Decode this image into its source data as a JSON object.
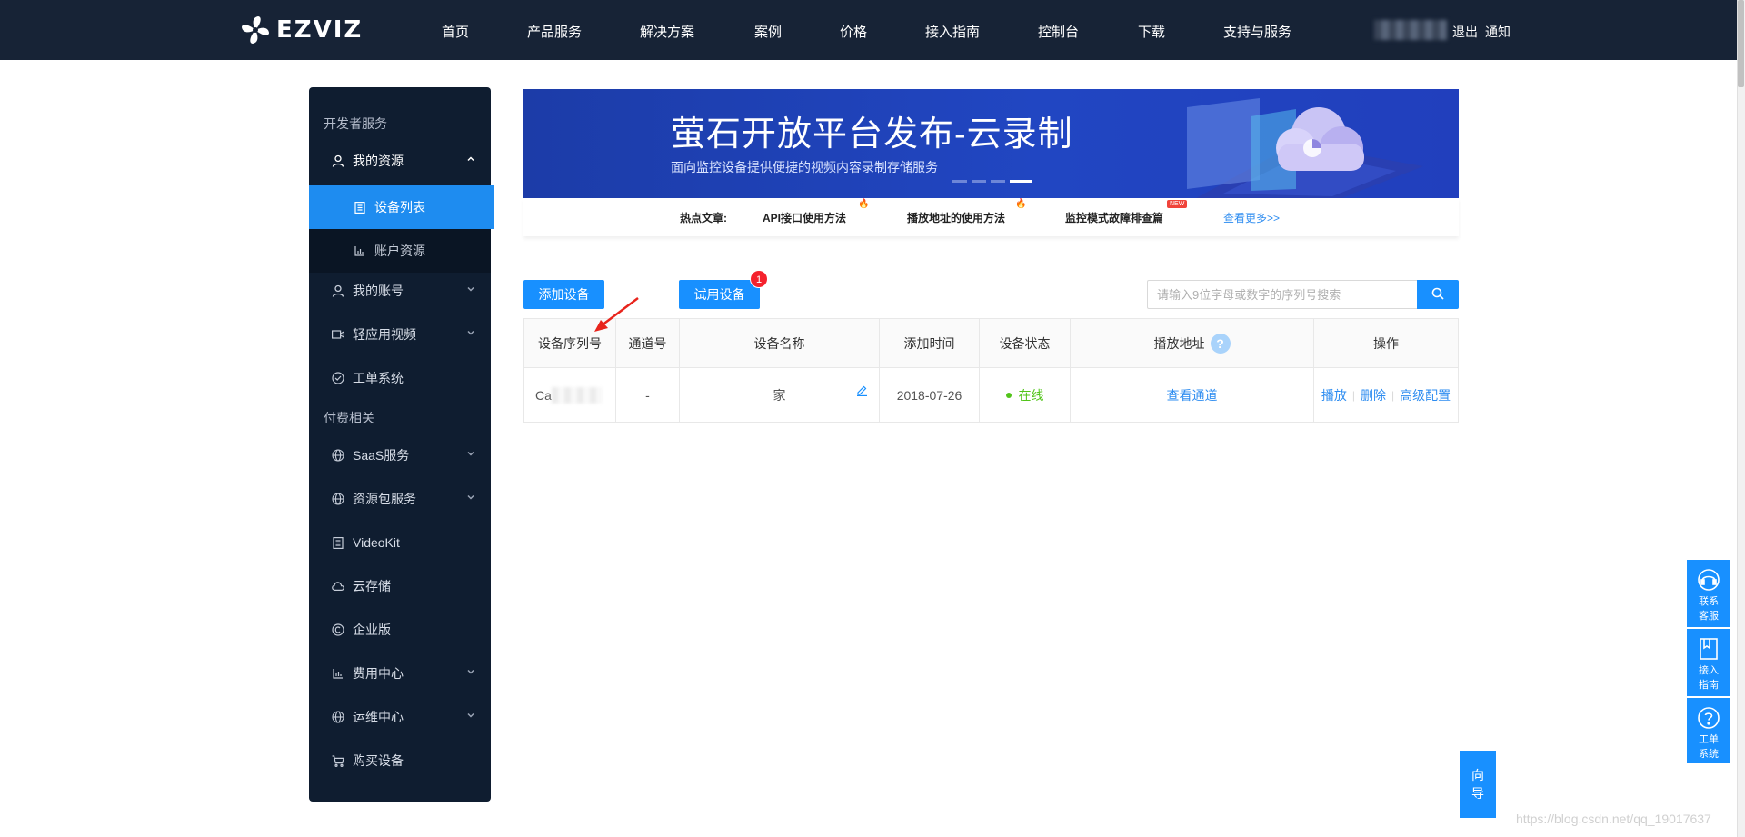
{
  "brand": {
    "name": "EZVIZ"
  },
  "nav": {
    "items": [
      "首页",
      "产品服务",
      "解决方案",
      "案例",
      "价格",
      "接入指南",
      "控制台",
      "下载",
      "支持与服务"
    ],
    "logout": "退出",
    "notify": "通知"
  },
  "sidebar": {
    "section_dev": "开发者服务",
    "my_resources": "我的资源",
    "device_list": "设备列表",
    "account_resources": "账户资源",
    "my_account": "我的账号",
    "light_video": "轻应用视频",
    "ticket_system": "工单系统",
    "section_paid": "付费相关",
    "saas": "SaaS服务",
    "resource_pack": "资源包服务",
    "videokit": "VideoKit",
    "cloud_storage": "云存储",
    "enterprise": "企业版",
    "billing": "费用中心",
    "ops": "运维中心",
    "buy_device": "购买设备"
  },
  "banner": {
    "title": "萤石开放平台发布-云录制",
    "subtitle": "面向监控设备提供便捷的视频内容录制存储服务"
  },
  "hot": {
    "label": "热点文章:",
    "articles": [
      "API接口使用方法",
      "播放地址的使用方法",
      "监控模式故障排查篇"
    ],
    "new_badge": "NEW",
    "more": "查看更多>>"
  },
  "toolbar": {
    "add_device": "添加设备",
    "trial_device": "试用设备",
    "trial_badge": "1",
    "search_placeholder": "请输入9位字母或数字的序列号搜索"
  },
  "table": {
    "headers": [
      "设备序列号",
      "通道号",
      "设备名称",
      "添加时间",
      "设备状态",
      "播放地址",
      "操作"
    ],
    "rows": [
      {
        "serial_prefix": "Ca",
        "channel": "-",
        "name": "家",
        "added": "2018-07-26",
        "status": "在线",
        "play_address": "查看通道",
        "actions": [
          "播放",
          "删除",
          "高级配置"
        ]
      }
    ]
  },
  "float": {
    "contact": [
      "联系",
      "客服"
    ],
    "guide": [
      "接入",
      "指南"
    ],
    "ticket": [
      "工单",
      "系统"
    ],
    "wizard": [
      "向",
      "导"
    ]
  },
  "watermark": "https://blog.csdn.net/qq_19017637"
}
